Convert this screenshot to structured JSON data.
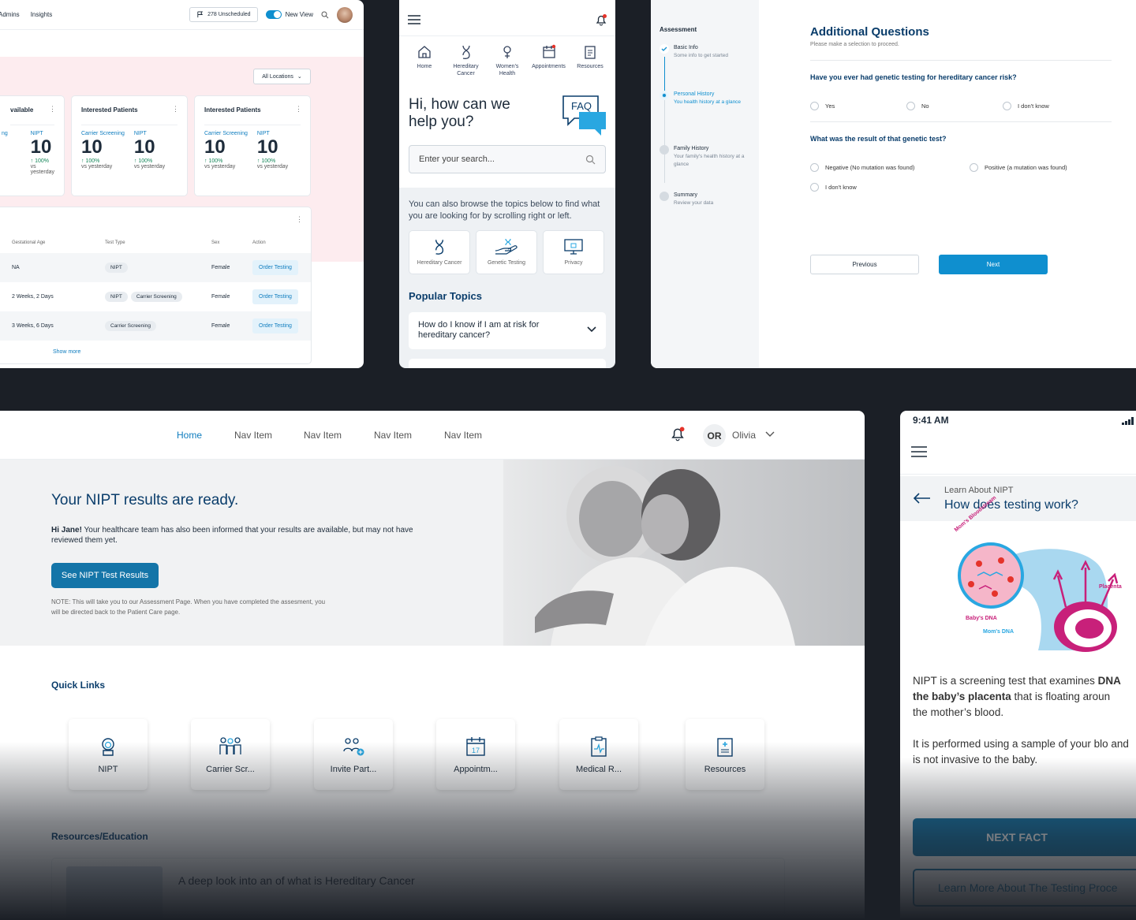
{
  "admin": {
    "nav": [
      "Admins",
      "Insights"
    ],
    "unscheduled": "278 Unscheduled",
    "new_view": "New View",
    "locations": "All Locations",
    "cards": [
      {
        "title": "vailable",
        "m1_label": "ng",
        "m1_value": "",
        "m2_label": "NIPT",
        "m2_value": "10",
        "pct": "100%",
        "since": "vs yesterday"
      },
      {
        "title": "Interested Patients",
        "m1_label": "Carrier Screening",
        "m1_value": "10",
        "m2_label": "NIPT",
        "m2_value": "10",
        "pct": "100%",
        "since": "vs yesterday"
      },
      {
        "title": "Interested Patients",
        "m1_label": "Carrier Screening",
        "m1_value": "10",
        "m2_label": "NIPT",
        "m2_value": "10",
        "pct": "100%",
        "since": "vs yesterday"
      }
    ],
    "columns": [
      "Gestational Age",
      "Test Type",
      "Sex",
      "Action"
    ],
    "rows": [
      {
        "age": "NA",
        "tests": [
          "NIPT"
        ],
        "sex": "Female",
        "action": "Order Testing"
      },
      {
        "age": "2 Weeks, 2 Days",
        "tests": [
          "NIPT",
          "Carrier Screening"
        ],
        "sex": "Female",
        "action": "Order Testing"
      },
      {
        "age": "3 Weeks, 6 Days",
        "tests": [
          "Carrier Screening"
        ],
        "sex": "Female",
        "action": "Order Testing"
      }
    ],
    "show_more": "Show more"
  },
  "help": {
    "nav": [
      {
        "label": "Home",
        "icon": "home-icon"
      },
      {
        "label": "Hereditary Cancer",
        "icon": "dna-icon"
      },
      {
        "label": "Women's Health",
        "icon": "female-icon"
      },
      {
        "label": "Appointments",
        "icon": "calendar-icon"
      },
      {
        "label": "Resources",
        "icon": "clipboard-icon"
      }
    ],
    "greeting": "Hi, how can we help you?",
    "faq_badge": "FAQ",
    "search_placeholder": "Enter your search...",
    "browse_text": "You can also browse the topics below to find what you are looking for by scrolling right or left.",
    "topics": [
      "Hereditary Cancer",
      "Genetic Testing",
      "Privacy"
    ],
    "popular_title": "Popular Topics",
    "faq_question": "How do I know if I am at risk for hereditary cancer?"
  },
  "assessment": {
    "sidebar_title": "Assessment",
    "steps": [
      {
        "title": "Basic Info",
        "desc": "Some info to get started"
      },
      {
        "title": "Personal History",
        "desc": "You health history at a glance"
      },
      {
        "title": "Family History",
        "desc": "Your family's health history at a glance"
      },
      {
        "title": "Summary",
        "desc": "Review your data"
      }
    ],
    "title": "Additional Questions",
    "subtitle": "Please make a selection to proceed.",
    "q1": "Have you ever had genetic testing for hereditary cancer risk?",
    "q1_options": [
      "Yes",
      "No",
      "I don't know"
    ],
    "q2": "What was the result of that genetic test?",
    "q2_options": [
      "Negative (No mutation was found)",
      "Positive (a mutation was found)",
      "I don't know"
    ],
    "previous": "Previous",
    "next": "Next"
  },
  "home": {
    "nav": [
      "Home",
      "Nav Item",
      "Nav Item",
      "Nav Item",
      "Nav Item"
    ],
    "user_initials": "OR",
    "user_name": "Olivia",
    "hero_title": "Your NIPT results are ready.",
    "hero_greeting": "Hi Jane!",
    "hero_text": "Your healthcare team has also been informed that your results are available, but may not have reviewed them yet.",
    "hero_button": "See NIPT Test Results",
    "hero_note": "NOTE: This will take you to our Assessment Page. When you have completed the assesment, you will be directed back to the Patient Care page.",
    "quick_links_title": "Quick Links",
    "quick_links": [
      {
        "label": "NIPT",
        "icon": "baby-icon"
      },
      {
        "label": "Carrier Scr...",
        "icon": "family-icon"
      },
      {
        "label": "Invite Part...",
        "icon": "invite-partner-icon"
      },
      {
        "label": "Appointm...",
        "icon": "calendar-icon"
      },
      {
        "label": "Medical R...",
        "icon": "medical-record-icon"
      },
      {
        "label": "Resources",
        "icon": "resources-icon"
      }
    ],
    "resources_title": "Resources/Education",
    "article_title": "A deep look into an of what is Hereditary Cancer"
  },
  "nipt_mobile": {
    "time": "9:41 AM",
    "section": "Learn About NIPT",
    "title": "How does testing work?",
    "diagram_labels": [
      "Mom's Bloodstream",
      "Placenta",
      "Baby's DNA",
      "Mom's DNA"
    ],
    "p1_a": "NIPT is a screening test that examines ",
    "p1_b": "DNA",
    "p1_c": "the baby’s placenta",
    "p1_d": " that is floating aroun",
    "p1_e": "the mother’s blood.",
    "p2": "It is performed using a sample of your blo and is not invasive to the baby.",
    "next_fact": "NEXT FACT",
    "learn_more": "Learn More About The Testing Proce"
  },
  "colors": {
    "brand_blue": "#0f8fcf",
    "navy": "#0a3d6b",
    "button_blue": "#1475a8",
    "dark_bg": "#1b1f26"
  }
}
